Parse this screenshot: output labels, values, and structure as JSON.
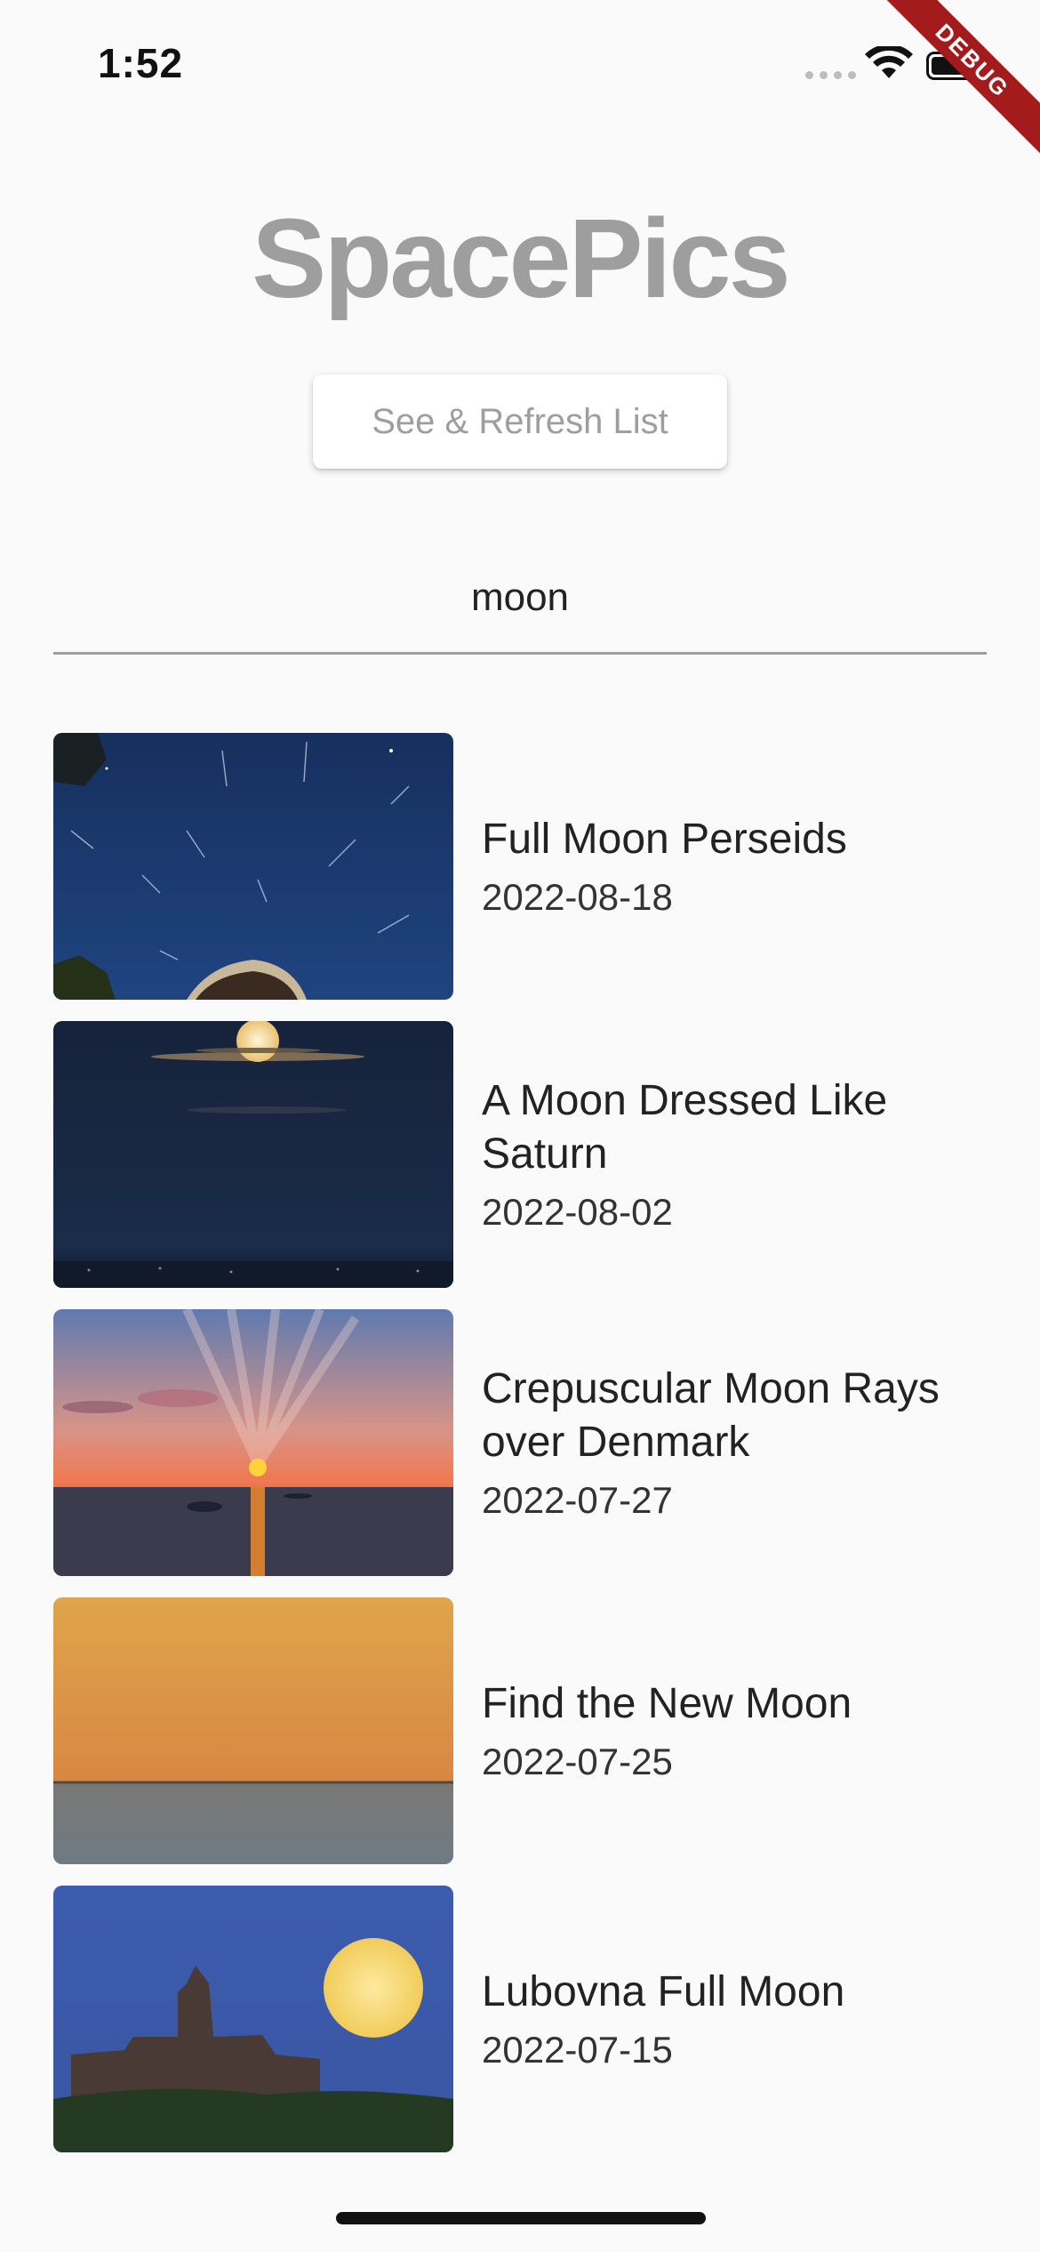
{
  "status_bar": {
    "time": "1:52",
    "debug_label": "DEBUG"
  },
  "header": {
    "title": "SpacePics",
    "refresh_button": "See & Refresh List"
  },
  "search": {
    "value": "moon"
  },
  "items": [
    {
      "title": "Full Moon Perseids",
      "date": "2022-08-18"
    },
    {
      "title": "A Moon Dressed Like Saturn",
      "date": "2022-08-02"
    },
    {
      "title": "Crepuscular Moon Rays over Denmark",
      "date": "2022-07-27"
    },
    {
      "title": "Find the New Moon",
      "date": "2022-07-25"
    },
    {
      "title": "Lubovna Full Moon",
      "date": "2022-07-15"
    }
  ],
  "colors": {
    "background": "#fafafa",
    "title_gray": "#9e9e9e",
    "debug_red": "#a31b1b"
  }
}
